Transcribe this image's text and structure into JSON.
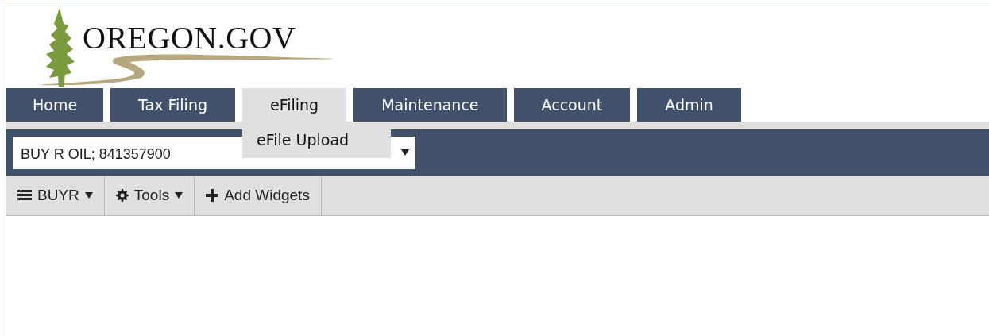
{
  "logo": {
    "text": "OREGON.GOV"
  },
  "tabs": [
    {
      "label": "Home",
      "selected": false
    },
    {
      "label": "Tax Filing",
      "selected": false
    },
    {
      "label": "eFiling",
      "selected": true,
      "menu": [
        "eFile Upload"
      ]
    },
    {
      "label": "Maintenance",
      "selected": false
    },
    {
      "label": "Account",
      "selected": false
    },
    {
      "label": "Admin",
      "selected": false
    }
  ],
  "account_select": {
    "value": "BUY R OIL; 841357900"
  },
  "toolbar": [
    {
      "kind": "list",
      "label": "BUYR",
      "dropdown": true
    },
    {
      "kind": "gear",
      "label": "Tools",
      "dropdown": true
    },
    {
      "kind": "plus",
      "label": "Add Widgets",
      "dropdown": false
    }
  ]
}
